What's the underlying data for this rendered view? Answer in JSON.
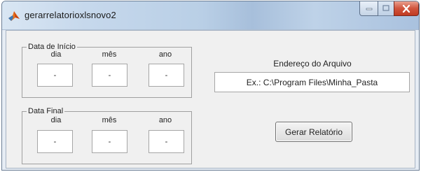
{
  "window": {
    "title": "gerarrelatorioxlsnovo2",
    "icon": "matlab-icon",
    "controls": [
      "minimize-icon",
      "maximize-icon",
      "close-icon"
    ]
  },
  "data_inicio": {
    "legend": "Data de Início",
    "day_label": "dia",
    "month_label": "mês",
    "year_label": "ano",
    "day_value": "-",
    "month_value": "-",
    "year_value": "-"
  },
  "data_final": {
    "legend": "Data Final",
    "day_label": "dia",
    "month_label": "mês",
    "year_label": "ano",
    "day_value": "-",
    "month_value": "-",
    "year_value": "-"
  },
  "arquivo": {
    "label": "Endereço do Arquivo",
    "value": "Ex.: C:\\Program Files\\Minha_Pasta"
  },
  "actions": {
    "generate_label": "Gerar Relatório"
  },
  "colors": {
    "close_button": "#c8452b",
    "client_background": "#f0f0f0"
  }
}
